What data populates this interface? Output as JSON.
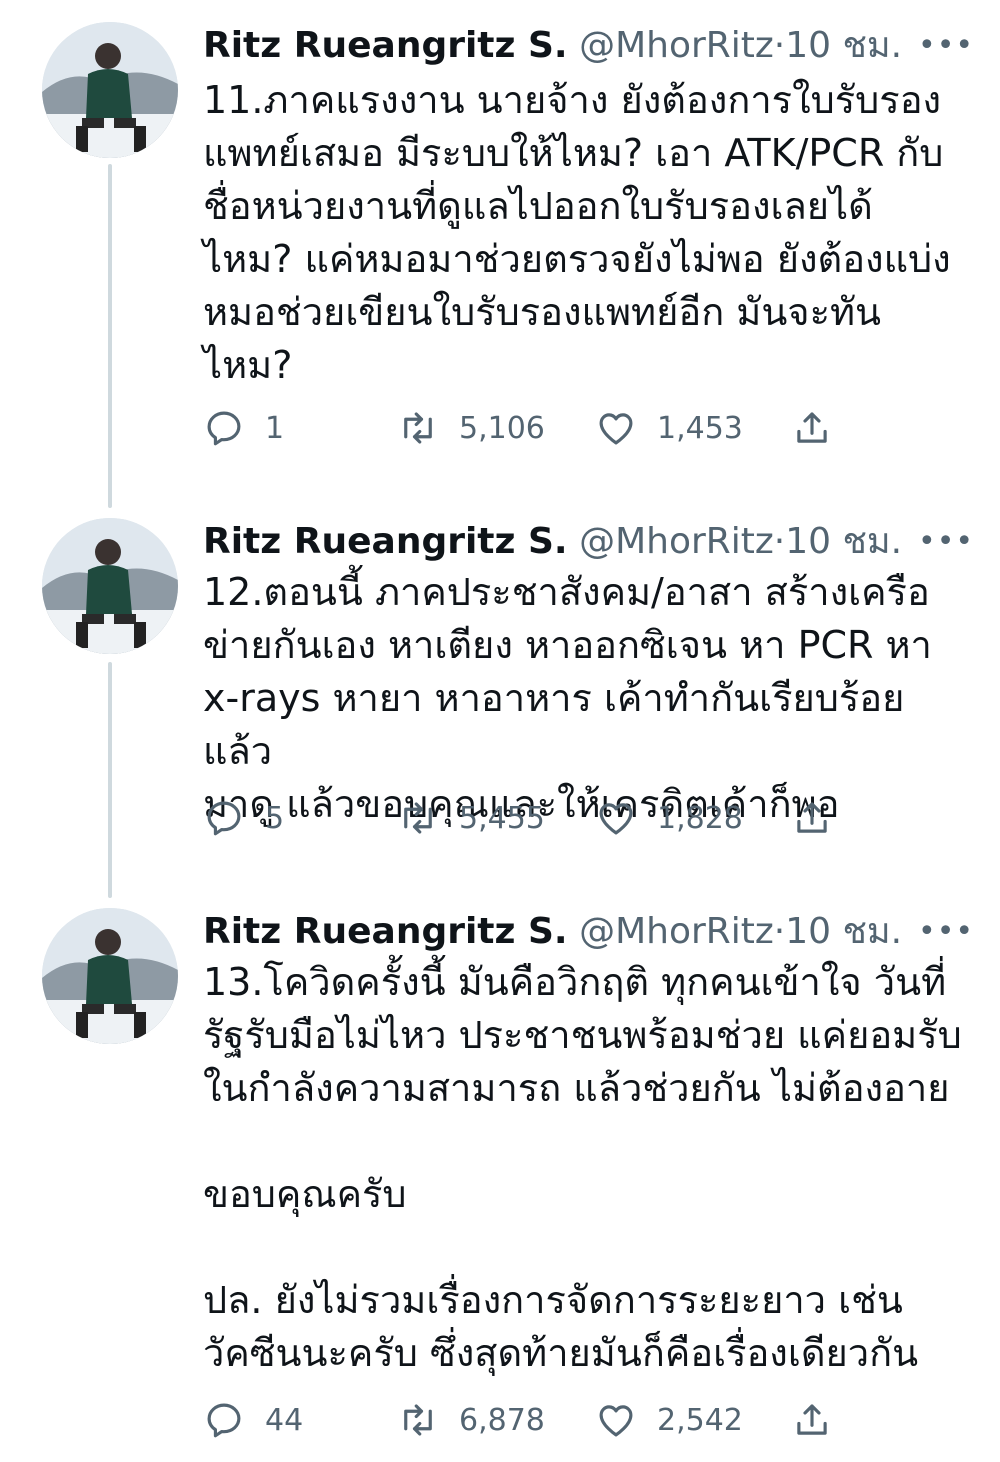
{
  "tweets": [
    {
      "author_name": "Ritz Rueangritz S.",
      "handle": "@MhorRitz",
      "separator": "·",
      "time": "10 ชม.",
      "more": "•••",
      "text": "11.ภาคแรงงาน นายจ้าง ยังต้องการใบรับรอง\nแพทย์เสมอ มีระบบให้ไหม? เอา ATK/PCR กับ\nชื่อหน่วยงานที่ดูแลไปออกใบรับรองเลยได้\nไหม? แค่หมอมาช่วยตรวจยังไม่พอ ยังต้องแบ่ง\nหมอช่วยเขียนใบรับรองแพทย์อีก มันจะทัน\nไหม?",
      "replies": "1",
      "retweets": "5,106",
      "likes": "1,453"
    },
    {
      "author_name": "Ritz Rueangritz S.",
      "handle": "@MhorRitz",
      "separator": "·",
      "time": "10 ชม.",
      "more": "•••",
      "text": "12.ตอนนี้ ภาคประชาสังคม/อาสา สร้างเครือ\nข่ายกันเอง หาเตียง หาออกซิเจน หา PCR หา\nx-rays หายา หาอาหาร เค้าทำกันเรียบร้อยแล้ว\nมาดู แล้วขอบคุณและให้เครดิตเค้าก็พอ",
      "replies": "5",
      "retweets": "5,455",
      "likes": "1,828"
    },
    {
      "author_name": "Ritz Rueangritz S.",
      "handle": "@MhorRitz",
      "separator": "·",
      "time": "10 ชม.",
      "more": "•••",
      "text": "13.โควิดครั้งนี้ มันคือวิกฤติ ทุกคนเข้าใจ วันที่\nรัฐรับมือไม่ไหว ประชาชนพร้อมช่วย แค่ยอมรับ\nในกำลังความสามารถ แล้วช่วยกัน ไม่ต้องอาย\n\nขอบคุณครับ\n\nปล. ยังไม่รวมเรื่องการจัดการระยะยาว เช่น\nวัคซีนนะครับ ซึ่งสุดท้ายมันก็คือเรื่องเดียวกัน",
      "replies": "44",
      "retweets": "6,878",
      "likes": "2,542"
    }
  ],
  "icons": {
    "reply": "reply-icon",
    "retweet": "retweet-icon",
    "like": "heart-icon",
    "share": "share-icon",
    "avatar": "avatar-photo"
  },
  "colors": {
    "text": "#0f1419",
    "secondary": "#536471",
    "thread_line": "#cfd9de",
    "background": "#ffffff"
  }
}
